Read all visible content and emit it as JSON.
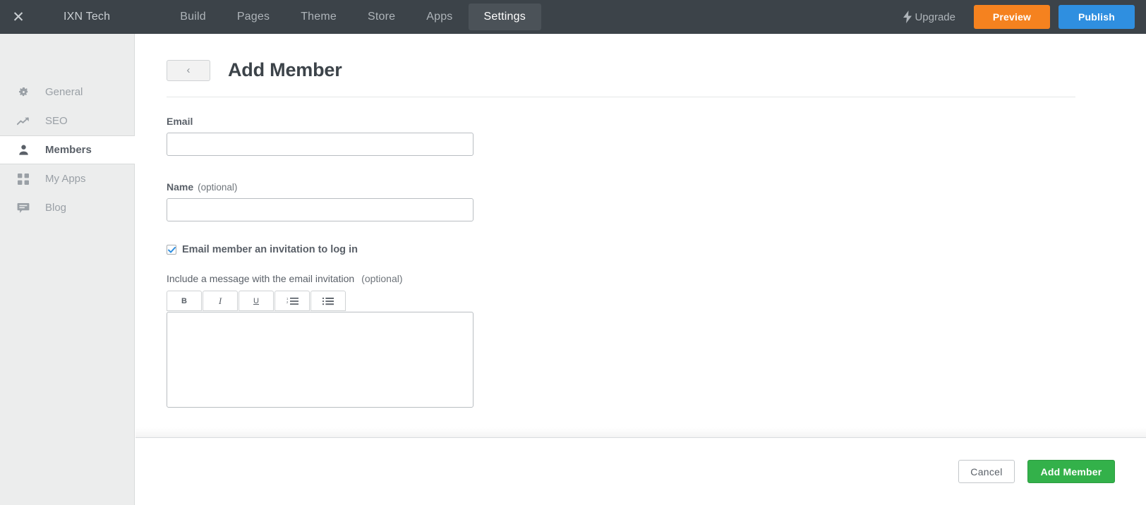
{
  "topbar": {
    "close_label": "✕",
    "brand": "IXN Tech",
    "nav": [
      {
        "label": "Build",
        "active": false
      },
      {
        "label": "Pages",
        "active": false
      },
      {
        "label": "Theme",
        "active": false
      },
      {
        "label": "Store",
        "active": false
      },
      {
        "label": "Apps",
        "active": false
      },
      {
        "label": "Settings",
        "active": true
      }
    ],
    "upgrade_label": "Upgrade",
    "preview_label": "Preview",
    "publish_label": "Publish",
    "colors": {
      "bar_bg": "#3c4349",
      "active_tab_bg": "#4b5258",
      "preview_bg": "#f5821f",
      "publish_bg": "#2f8fe0"
    }
  },
  "sidebar": {
    "items": [
      {
        "label": "General",
        "icon": "gear-icon",
        "active": false
      },
      {
        "label": "SEO",
        "icon": "trending-up-icon",
        "active": false
      },
      {
        "label": "Members",
        "icon": "person-icon",
        "active": true
      },
      {
        "label": "My Apps",
        "icon": "grid-icon",
        "active": false
      },
      {
        "label": "Blog",
        "icon": "comment-icon",
        "active": false
      }
    ]
  },
  "page": {
    "back_label": "‹",
    "title": "Add Member"
  },
  "form": {
    "email": {
      "label": "Email",
      "value": "",
      "placeholder": ""
    },
    "name": {
      "label": "Name",
      "optional": "(optional)",
      "value": "",
      "placeholder": ""
    },
    "invite_checkbox": {
      "label": "Email member an invitation to log in",
      "checked": true
    },
    "message": {
      "label": "Include a message with the email invitation",
      "optional": "(optional)",
      "value": "",
      "placeholder": ""
    },
    "toolbar": [
      {
        "label": "B",
        "name": "bold-button"
      },
      {
        "label": "I",
        "name": "italic-button"
      },
      {
        "label": "U",
        "name": "underline-button"
      },
      {
        "label": "",
        "name": "ordered-list-button"
      },
      {
        "label": "",
        "name": "unordered-list-button"
      }
    ]
  },
  "footer": {
    "cancel_label": "Cancel",
    "submit_label": "Add Member",
    "submit_color": "#33b14a"
  }
}
